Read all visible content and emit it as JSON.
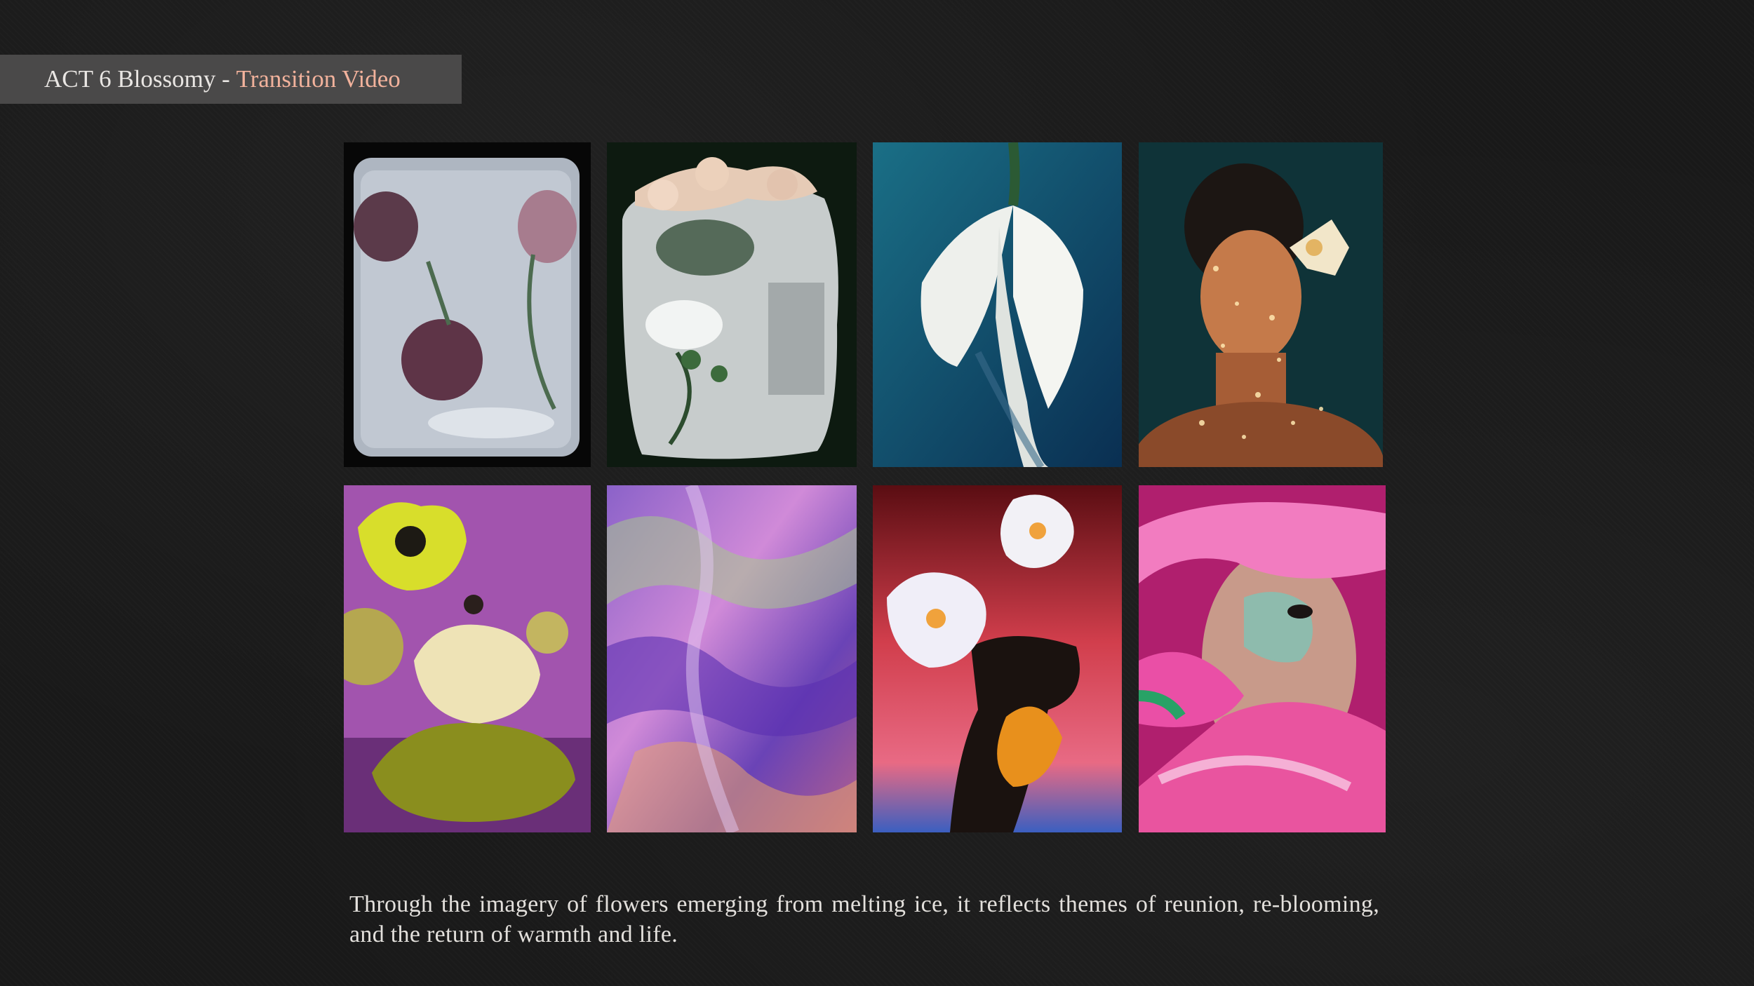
{
  "header": {
    "title_main": "ACT 6 Blossomy",
    "title_separator": " - ",
    "title_accent": "Transition Video",
    "accent_color": "#f2b29c"
  },
  "gallery": {
    "images": [
      {
        "name": "Roses frozen in a block of ice",
        "icon": "image"
      },
      {
        "name": "Blossoms and leaves in melting ice",
        "icon": "image"
      },
      {
        "name": "White lily on teal background",
        "icon": "image"
      },
      {
        "name": "Portrait with lily and dappled light",
        "icon": "image"
      },
      {
        "name": "Figure among yellow flowers on purple",
        "icon": "image"
      },
      {
        "name": "Abstract swirling colour painting",
        "icon": "image"
      },
      {
        "name": "Woman with tulips on red-blue gradient",
        "icon": "image"
      },
      {
        "name": "Face overlaid with pink petals",
        "icon": "image"
      }
    ]
  },
  "caption": {
    "text": "Through the imagery of flowers emerging from melting ice, it reflects themes of reunion, re-blooming, and the return of warmth and life."
  },
  "colors": {
    "background": "#191919",
    "title_bar": "#4a4949",
    "text": "#e3e0dc"
  }
}
